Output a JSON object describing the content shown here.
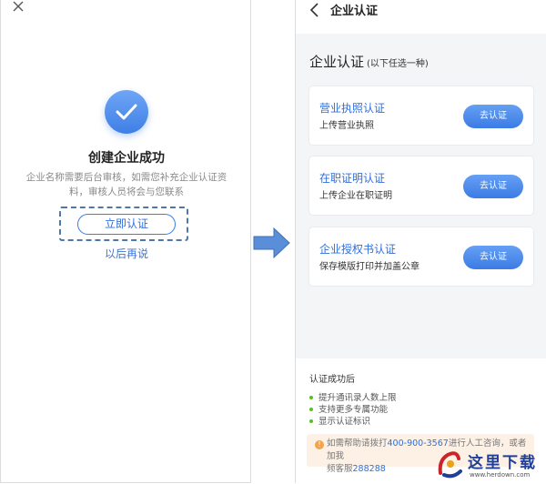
{
  "left": {
    "title": "创建企业成功",
    "desc_line1": "企业名称需要后台审核，如需您补充企业认证资",
    "desc_line2": "料，审核人员将会与您联系",
    "verify_button": "立即认证",
    "later_link": "以后再说"
  },
  "right": {
    "nav_title": "企业认证",
    "section_title": "企业认证",
    "section_hint": "(以下任选一种)",
    "cards": [
      {
        "title": "营业执照认证",
        "subtitle": "上传营业执照",
        "button": "去认证"
      },
      {
        "title": "在职证明认证",
        "subtitle": "上传企业在职证明",
        "button": "去认证"
      },
      {
        "title": "企业授权书认证",
        "subtitle": "保存模版打印并加盖公章",
        "button": "去认证"
      }
    ],
    "after_title": "认证成功后",
    "benefits": [
      "提升通讯录人数上限",
      "支持更多专属功能",
      "显示认证标识"
    ],
    "help": {
      "prefix": "如需帮助请拨打",
      "phone": "400-900-3567",
      "middle": "进行人工咨询，或者加我",
      "prefix2": "频客服",
      "qq": "288288"
    }
  },
  "watermark": {
    "name": "这里下载",
    "url": "www.herdown.com"
  },
  "colors": {
    "accent": "#3b7be4",
    "success_dot": "#52c41a",
    "help_bg": "#fdf1e6"
  }
}
